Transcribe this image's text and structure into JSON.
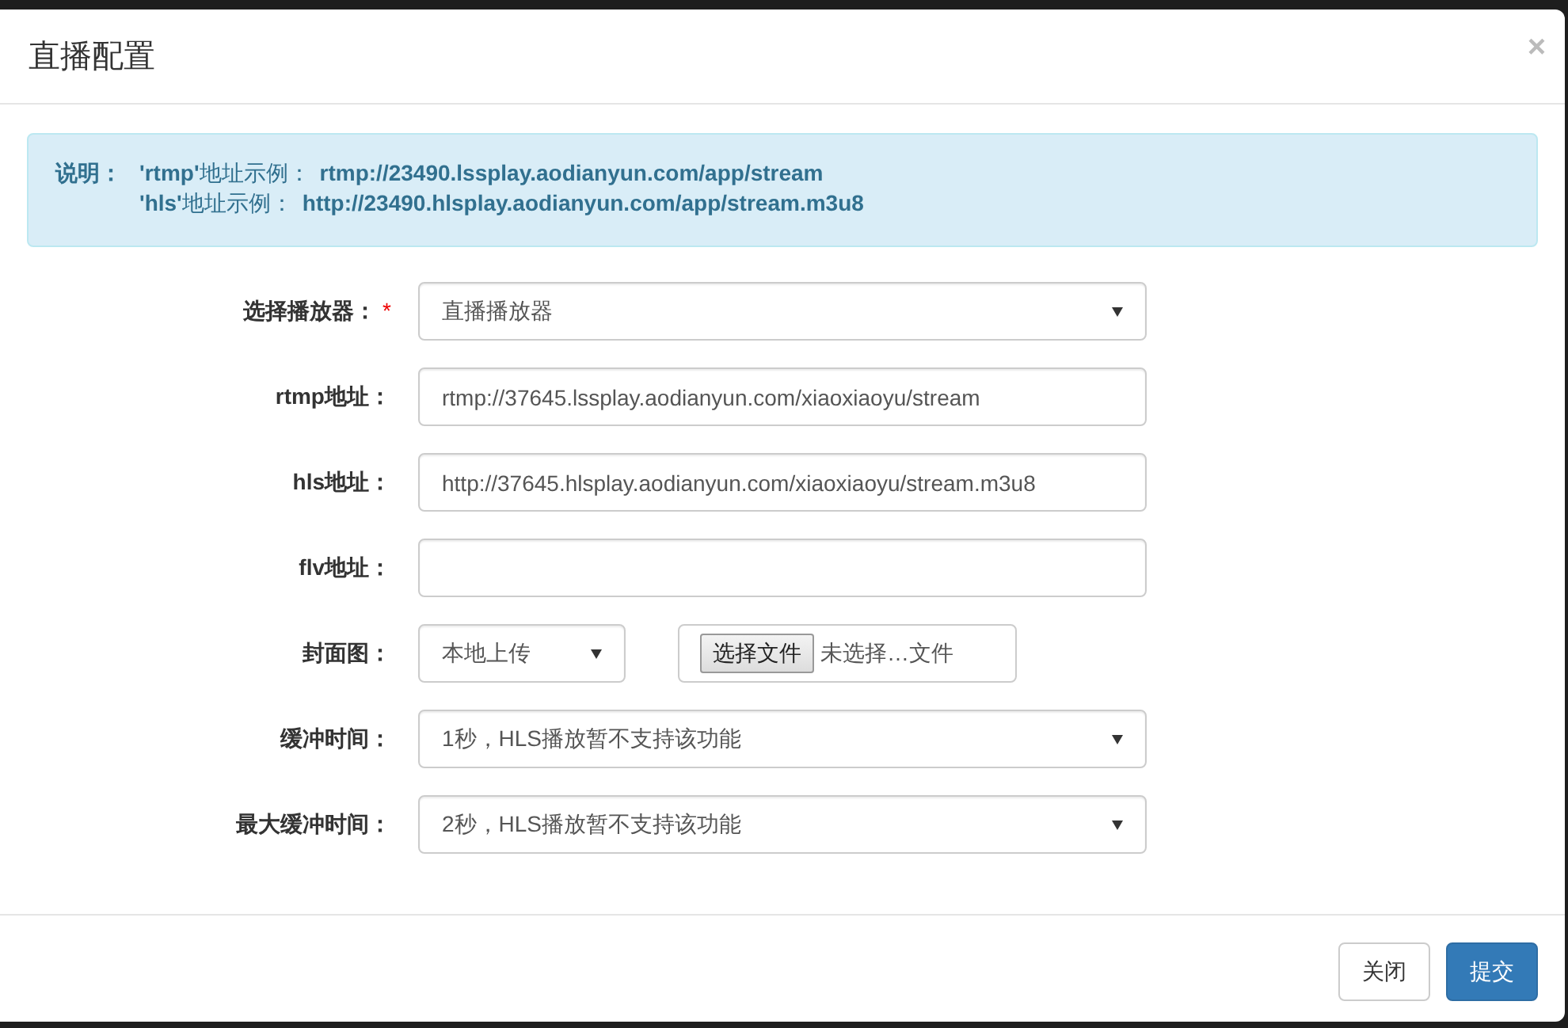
{
  "dialog": {
    "title": "直播配置",
    "close_symbol": "×",
    "required_symbol": "*"
  },
  "notice": {
    "lines": [
      {
        "prefix": "说明：",
        "text": "**'rtmp'**地址示例：",
        "url": "rtmp://23490.lssplay.aodianyun.com/app/stream"
      },
      {
        "text": "**'hls'**地址示例：",
        "url": "http://23490.hlsplay.aodianyun.com/app/stream.m3u8"
      }
    ]
  },
  "fields": [
    {
      "kind": "select",
      "label": "选择播放器：",
      "required": true,
      "value": "直播播放器"
    },
    {
      "kind": "input",
      "label": "rtmp地址：",
      "required": false,
      "value": "rtmp://37645.lssplay.aodianyun.com/xiaoxiaoyu/stream"
    },
    {
      "kind": "input",
      "label": "hls地址：",
      "required": false,
      "value": "http://37645.hlsplay.aodianyun.com/xiaoxiaoyu/stream.m3u8"
    },
    {
      "kind": "input",
      "label": "flv地址：",
      "required": false
    },
    {
      "kind": "cover",
      "label": "封面图：",
      "required": false,
      "value": "本地上传",
      "file_button": "选择文件",
      "file_status": "未选择…文件"
    },
    {
      "kind": "select",
      "label": "缓冲时间：",
      "required": false,
      "value": "1秒，HLS播放暂不支持该功能"
    },
    {
      "kind": "select",
      "label": "最大缓冲时间：",
      "required": false,
      "value": "2秒，HLS播放暂不支持该功能"
    }
  ],
  "buttons": [
    {
      "label": "关闭",
      "kind": "secondary"
    },
    {
      "label": "提交",
      "kind": "primary"
    }
  ]
}
